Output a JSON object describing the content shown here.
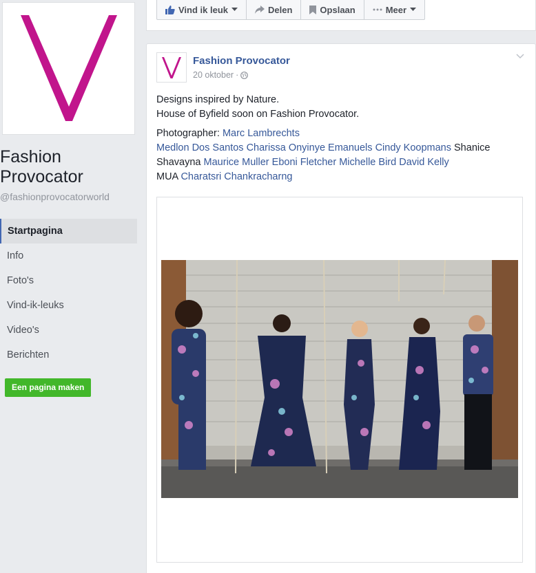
{
  "page": {
    "name": "Fashion Provocator",
    "handle": "@fashionprovocatorworld",
    "logo_color": "#c1158c"
  },
  "nav": {
    "items": [
      {
        "label": "Startpagina",
        "active": true
      },
      {
        "label": "Info"
      },
      {
        "label": "Foto's"
      },
      {
        "label": "Vind-ik-leuks"
      },
      {
        "label": "Video's"
      },
      {
        "label": "Berichten"
      }
    ],
    "create_page": "Een pagina maken"
  },
  "actions": {
    "like": "Vind ik leuk",
    "share": "Delen",
    "save": "Opslaan",
    "more": "Meer"
  },
  "post": {
    "author": "Fashion Provocator",
    "date": "20 oktober",
    "separator": "·",
    "line1": "Designs inspired by Nature.",
    "line2": "House of Byfield soon on Fashion Provocator.",
    "photographer_label": "Photographer:",
    "photographer": "Marc Lambrechts",
    "models": [
      "Medlon Dos Santos",
      "Charissa Onyinye Emanuels",
      "Cindy Koopmans"
    ],
    "plain_name": "Shanice Shavayna",
    "models2": [
      "Maurice Muller",
      "Eboni Fletcher",
      "Michelle Bird",
      "David Kelly"
    ],
    "mua_label": "MUA",
    "mua": "Charatsri Chankracharng"
  },
  "colors": {
    "link": "#365899",
    "green": "#42b72a",
    "bg": "#e9ebee"
  }
}
